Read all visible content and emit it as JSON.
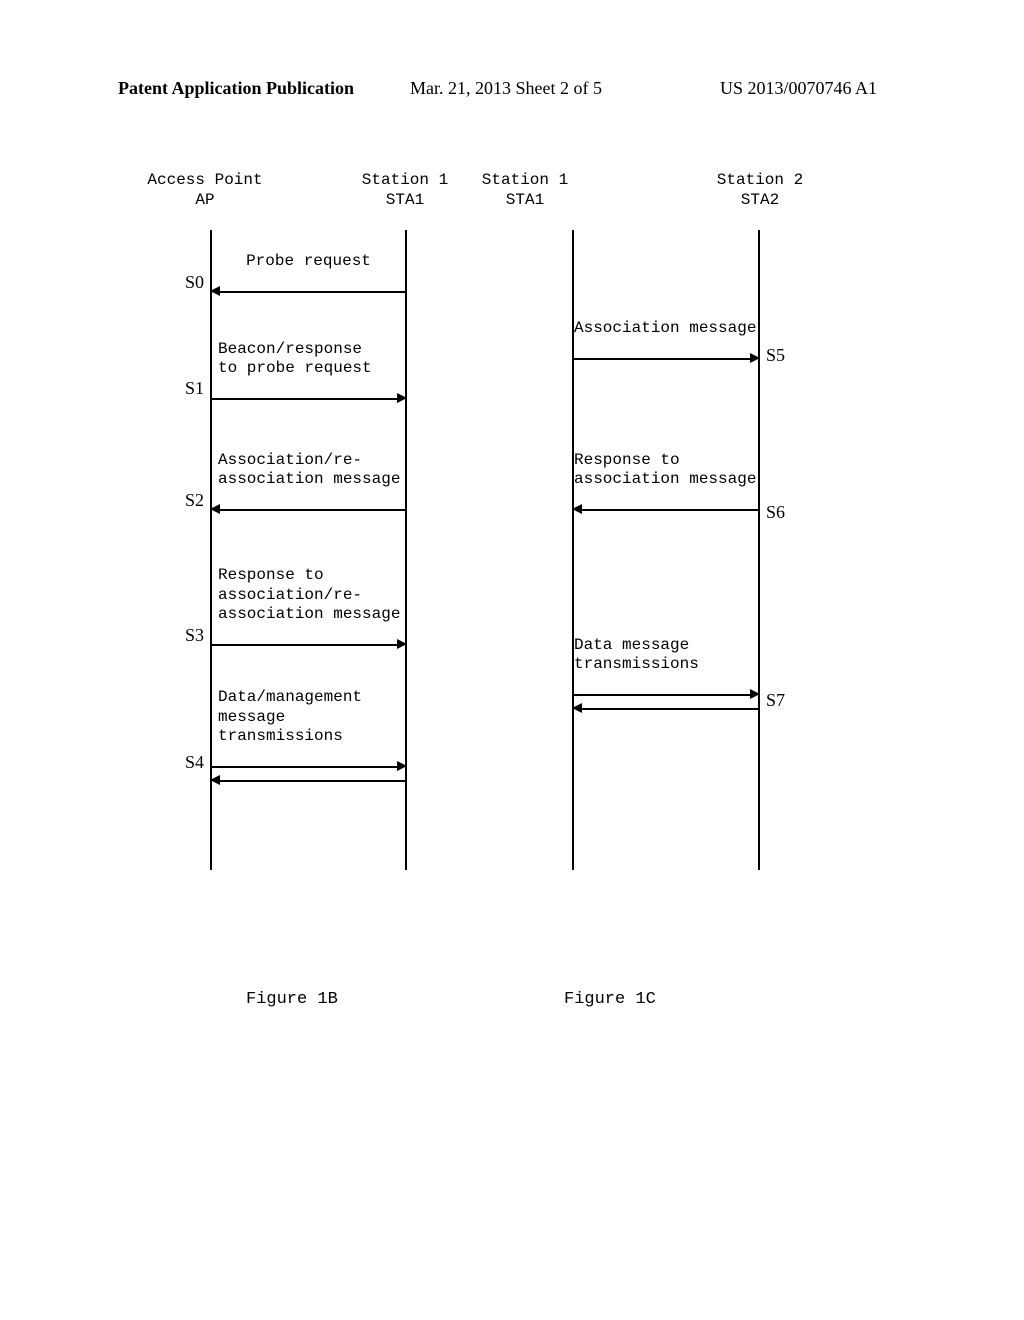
{
  "header": {
    "publication": "Patent Application Publication",
    "date_sheet": "Mar. 21, 2013  Sheet 2 of 5",
    "docnum": "US 2013/0070746 A1"
  },
  "lifelines": {
    "ap": {
      "line1": "Access Point",
      "line2": "AP"
    },
    "sta1a": {
      "line1": "Station 1",
      "line2": "STA1"
    },
    "sta1b": {
      "line1": "Station 1",
      "line2": "STA1"
    },
    "sta2": {
      "line1": "Station 2",
      "line2": "STA2"
    }
  },
  "steps": {
    "s0": "S0",
    "s1": "S1",
    "s2": "S2",
    "s3": "S3",
    "s4": "S4",
    "s5": "S5",
    "s6": "S6",
    "s7": "S7"
  },
  "messages": {
    "m0": "Probe request",
    "m1": "Beacon/response\nto probe request",
    "m2": "Association/re-\nassociation message",
    "m3": "Response to\nassociation/re-\nassociation message",
    "m4": "Data/management\nmessage\ntransmissions",
    "m5": "Association message",
    "m6": "Response to\nassociation message",
    "m7": "Data message\ntransmissions"
  },
  "captions": {
    "fig1b": "Figure 1B",
    "fig1c": "Figure 1C"
  }
}
